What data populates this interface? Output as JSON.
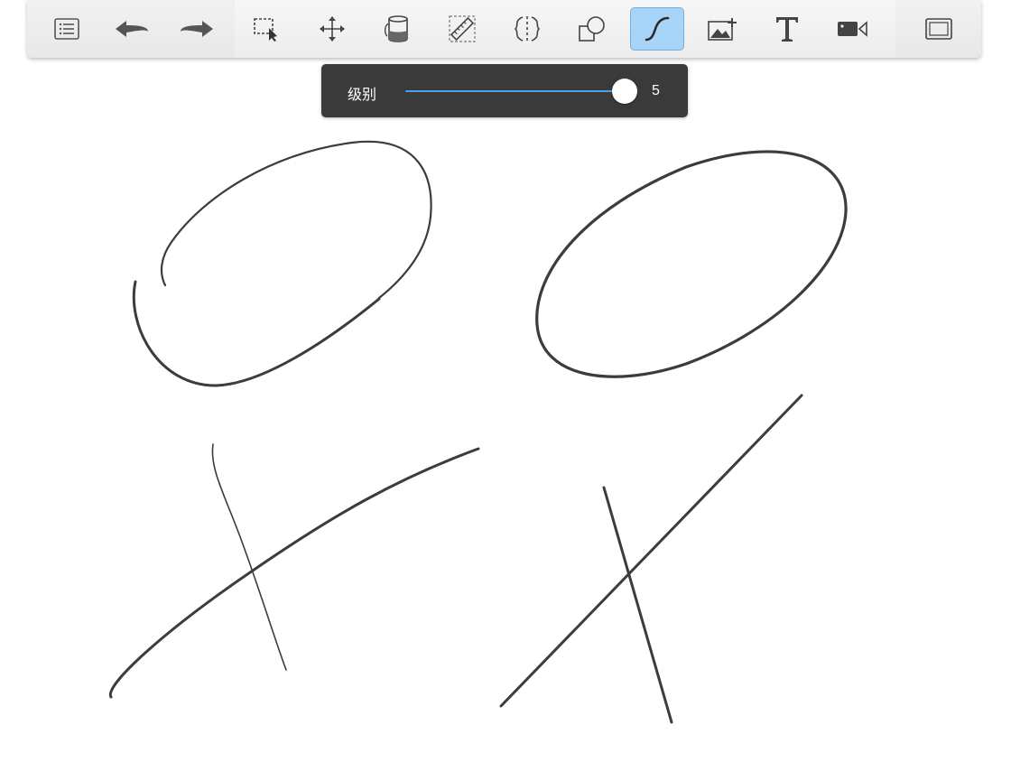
{
  "toolbar": {
    "tools": [
      {
        "name": "layers-list",
        "icon": "list-icon"
      },
      {
        "name": "undo",
        "icon": "undo-arrow-icon"
      },
      {
        "name": "redo",
        "icon": "redo-arrow-icon"
      },
      {
        "name": "selection",
        "icon": "marquee-select-icon"
      },
      {
        "name": "transform",
        "icon": "move-arrows-icon"
      },
      {
        "name": "fill",
        "icon": "paint-bucket-icon"
      },
      {
        "name": "ruler",
        "icon": "ruler-icon"
      },
      {
        "name": "symmetry",
        "icon": "symmetry-icon"
      },
      {
        "name": "shapes",
        "icon": "shapes-icon"
      },
      {
        "name": "stroke-smoothing",
        "icon": "curve-s-icon",
        "active": true
      },
      {
        "name": "add-image",
        "icon": "image-add-icon"
      },
      {
        "name": "text",
        "icon": "text-t-icon"
      },
      {
        "name": "recording",
        "icon": "video-camera-icon"
      },
      {
        "name": "fullscreen",
        "icon": "fullscreen-frame-icon"
      }
    ],
    "active_color": "#a8d4f7"
  },
  "level_popup": {
    "label": "级别",
    "value": "5",
    "slider_fraction": 1.0,
    "track_color": "#4aa3ec"
  },
  "canvas": {
    "stroke_color": "#3f3a3c"
  }
}
